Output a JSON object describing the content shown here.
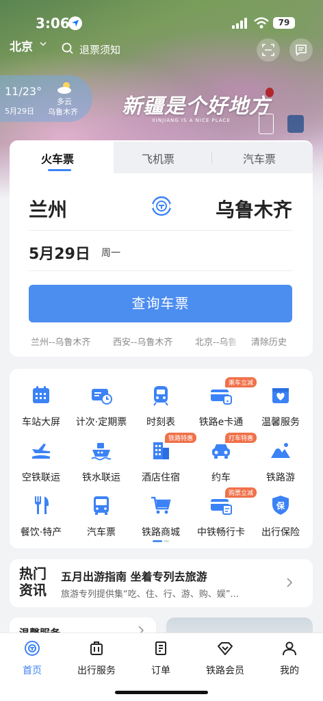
{
  "status": {
    "time": "3:06",
    "battery": "79"
  },
  "topbar": {
    "city": "北京",
    "search_text": "退票须知"
  },
  "weather": {
    "date": "11/23°",
    "day": "5月29日",
    "condition": "多云",
    "city": "乌鲁木齐"
  },
  "banner": {
    "title": "新疆是个好地方",
    "subtitle": "XINJIANG IS A NICE PLACE"
  },
  "booking": {
    "tabs": [
      "火车票",
      "飞机票",
      "汽车票"
    ],
    "from": "兰州",
    "to": "乌鲁木齐",
    "date": "5月29日",
    "weekday": "周一",
    "search_label": "查询车票",
    "history": [
      "兰州--乌鲁木齐",
      "西安--乌鲁木齐",
      "北京--乌鲁"
    ],
    "clear_history": "清除历史"
  },
  "services": [
    {
      "label": "车站大屏",
      "icon": "station-screen-icon"
    },
    {
      "label": "计次·定期票",
      "icon": "ticket-clock-icon"
    },
    {
      "label": "时刻表",
      "icon": "train-icon"
    },
    {
      "label": "铁路e卡通",
      "icon": "railway-card-icon",
      "tag": "乘车立减"
    },
    {
      "label": "温馨服务",
      "icon": "heart-service-icon"
    },
    {
      "label": "空铁联运",
      "icon": "plane-train-icon"
    },
    {
      "label": "铁水联运",
      "icon": "ship-icon"
    },
    {
      "label": "酒店住宿",
      "icon": "hotel-icon",
      "tag": "铁路特惠"
    },
    {
      "label": "约车",
      "icon": "car-icon",
      "tag": "打车特惠"
    },
    {
      "label": "铁路游",
      "icon": "mountain-icon"
    },
    {
      "label": "餐饮·特产",
      "icon": "fork-knife-icon"
    },
    {
      "label": "汽车票",
      "icon": "bus-icon"
    },
    {
      "label": "铁路商城",
      "icon": "cart-icon"
    },
    {
      "label": "中铁畅行卡",
      "icon": "card-icon",
      "tag": "购票立减"
    },
    {
      "label": "出行保险",
      "icon": "shield-insurance-icon"
    }
  ],
  "news": {
    "badge_line1": "热门",
    "badge_line2": "资讯",
    "title": "五月出游指南 坐着专列去旅游",
    "subtitle": "旅游专列提供集“吃、住、行、游、购、娱”..."
  },
  "peek": {
    "left_title": "温馨服务"
  },
  "bottom_nav": [
    {
      "label": "首页",
      "icon": "home-icon",
      "active": true
    },
    {
      "label": "出行服务",
      "icon": "luggage-icon"
    },
    {
      "label": "订单",
      "icon": "order-icon"
    },
    {
      "label": "铁路会员",
      "icon": "diamond-icon"
    },
    {
      "label": "我的",
      "icon": "person-icon"
    }
  ],
  "colors": {
    "accent": "#4c8df0",
    "tag": "#f0714a",
    "icon": "#3b82f6"
  }
}
